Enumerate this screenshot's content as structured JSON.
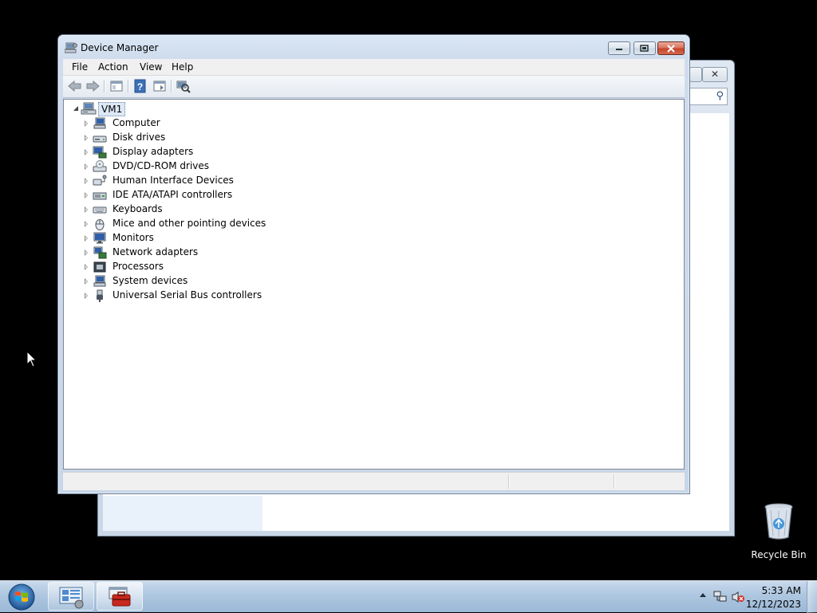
{
  "window": {
    "title": "Device Manager",
    "title_icon": "device-manager-icon"
  },
  "menu": [
    "File",
    "Action",
    "View",
    "Help"
  ],
  "toolbar": {
    "buttons": [
      "back-arrow-icon",
      "forward-arrow-icon",
      "show-hide-console-tree-icon",
      "help-icon",
      "properties-icon",
      "scan-hardware-icon"
    ]
  },
  "tree": {
    "root": "VM1",
    "nodes": [
      {
        "label": "Computer",
        "icon": "computer-icon"
      },
      {
        "label": "Disk drives",
        "icon": "disk-drive-icon"
      },
      {
        "label": "Display adapters",
        "icon": "display-adapter-icon"
      },
      {
        "label": "DVD/CD-ROM drives",
        "icon": "dvd-drive-icon"
      },
      {
        "label": "Human Interface Devices",
        "icon": "hid-icon"
      },
      {
        "label": "IDE ATA/ATAPI controllers",
        "icon": "ide-controller-icon"
      },
      {
        "label": "Keyboards",
        "icon": "keyboard-icon"
      },
      {
        "label": "Mice and other pointing devices",
        "icon": "mouse-icon"
      },
      {
        "label": "Monitors",
        "icon": "monitor-icon"
      },
      {
        "label": "Network adapters",
        "icon": "network-adapter-icon"
      },
      {
        "label": "Processors",
        "icon": "processor-icon"
      },
      {
        "label": "System devices",
        "icon": "system-devices-icon"
      },
      {
        "label": "Universal Serial Bus controllers",
        "icon": "usb-icon"
      }
    ]
  },
  "desktop": {
    "recycle_bin_label": "Recycle Bin"
  },
  "taskbar": {
    "tasks": [
      "server-manager-icon",
      "device-manager-taskbar-icon"
    ],
    "tray_icons": [
      "show-hidden-icons-icon",
      "network-icon",
      "volume-muted-icon"
    ],
    "time": "5:33 AM",
    "date": "12/12/2023"
  }
}
